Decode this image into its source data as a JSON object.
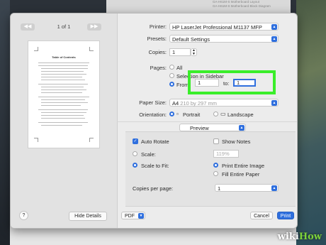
{
  "background_doc": {
    "lines": [
      "GA-H61M-S Motherboard Layout",
      "GA-H61M-S Motherboard Block Diagram"
    ]
  },
  "preview": {
    "page_indicator": "1 of 1",
    "prev_icon": "chevron-left-icon",
    "next_icon": "chevron-right-icon",
    "thumb_title": "Table of Contents",
    "hide_details_label": "Hide Details",
    "help_label": "?"
  },
  "printer": {
    "label": "Printer:",
    "value": "HP LaserJet Professional M1137 MFP"
  },
  "presets": {
    "label": "Presets:",
    "value": "Default Settings"
  },
  "copies": {
    "label": "Copies:",
    "value": "1"
  },
  "pages": {
    "label": "Pages:",
    "all_label": "All",
    "selection_label": "Selection in Sidebar",
    "from_label": "From:",
    "from_value": "1",
    "to_label": "to:",
    "to_value": "1",
    "selected": "from"
  },
  "paper_size": {
    "label": "Paper Size:",
    "value": "A4",
    "dimensions": "210 by 297 mm"
  },
  "orientation": {
    "label": "Orientation:",
    "portrait_label": "Portrait",
    "landscape_label": "Landscape",
    "selected": "portrait"
  },
  "section_select": {
    "value": "Preview"
  },
  "preview_options": {
    "auto_rotate_label": "Auto Rotate",
    "auto_rotate_checked": true,
    "show_notes_label": "Show Notes",
    "show_notes_checked": false,
    "scale_label": "Scale:",
    "scale_value": "119%",
    "scale_to_fit_label": "Scale to Fit:",
    "print_entire_image_label": "Print Entire Image",
    "fill_entire_paper_label": "Fill Entire Paper",
    "copies_per_page_label": "Copies per page:",
    "copies_per_page_value": "1"
  },
  "footer": {
    "pdf_label": "PDF",
    "cancel_label": "Cancel",
    "print_label": "Print"
  },
  "watermark": {
    "part1": "wiki",
    "part2": "How"
  },
  "colors": {
    "accent": "#2f6fde",
    "highlight": "#3aee2a"
  }
}
